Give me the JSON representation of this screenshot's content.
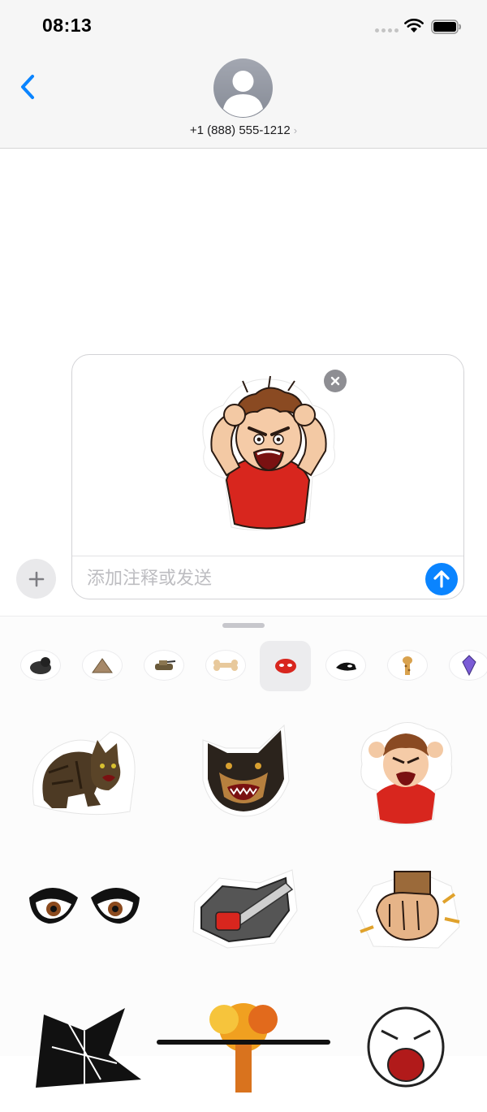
{
  "status_bar": {
    "time": "08:13"
  },
  "header": {
    "contact": "+1 (888) 555-1212",
    "chevron": "›"
  },
  "compose": {
    "placeholder": "添加注释或发送",
    "attached_sticker": "angry-boy-sticker"
  },
  "sticker_packs": [
    {
      "icon": "gorilla-icon"
    },
    {
      "icon": "pyramid-icon"
    },
    {
      "icon": "tank-icon"
    },
    {
      "icon": "bone-icon"
    },
    {
      "icon": "angry-face-icon",
      "selected": true
    },
    {
      "icon": "orca-icon"
    },
    {
      "icon": "giraffe-icon"
    },
    {
      "icon": "crystal-icon"
    }
  ],
  "stickers": [
    "angry-cat-sticker",
    "snarling-dog-sticker",
    "angry-boy-sticker",
    "angry-eyes-sticker",
    "chainsaw-sticker",
    "punching-fist-sticker",
    "shattered-glass-sticker",
    "explosion-sticker",
    "screaming-face-sticker"
  ],
  "colors": {
    "accent": "#0a84ff",
    "shirt": "#d8261e"
  }
}
